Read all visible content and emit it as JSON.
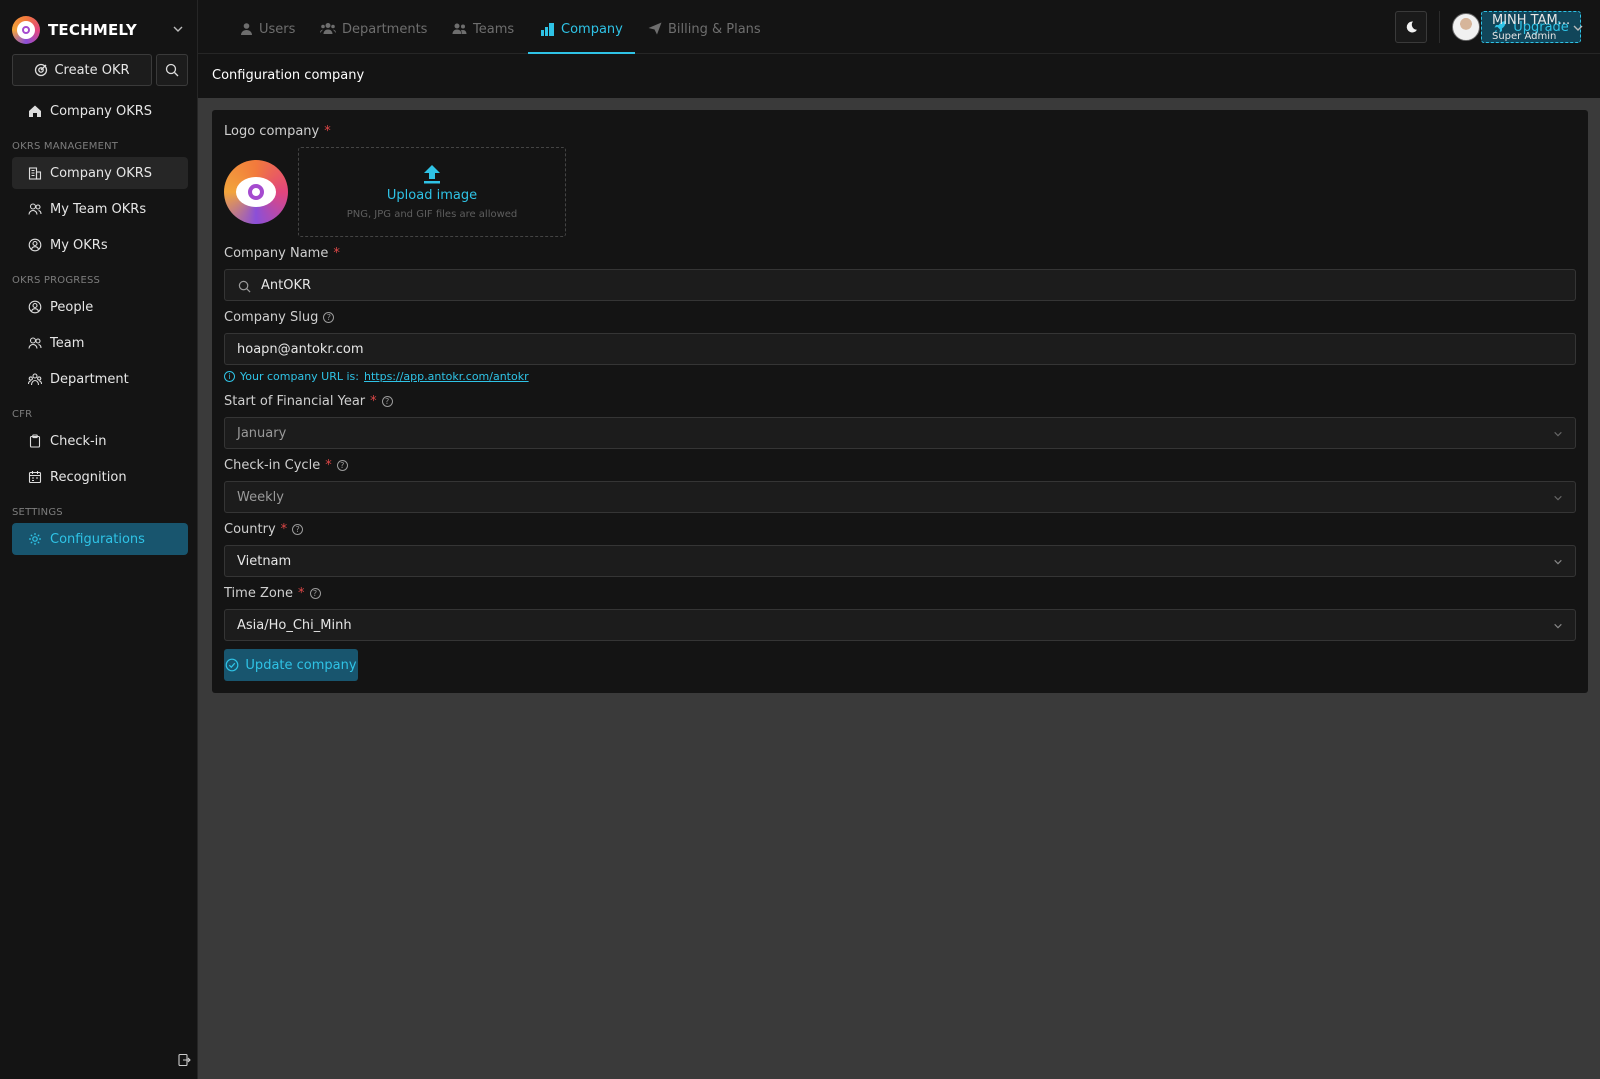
{
  "brand": {
    "name": "TECHMELY"
  },
  "sidebar": {
    "create_okr": "Create OKR",
    "home": "Company OKRS",
    "sections": [
      {
        "title": "OKRS MANAGEMENT",
        "items": [
          "Company OKRS",
          "My Team OKRs",
          "My OKRs"
        ]
      },
      {
        "title": "OKRS PROGRESS",
        "items": [
          "People",
          "Team",
          "Department"
        ]
      },
      {
        "title": "CFR",
        "items": [
          "Check-in",
          "Recognition"
        ]
      },
      {
        "title": "SETTINGS",
        "items": [
          "Configurations"
        ]
      }
    ]
  },
  "topbar": {
    "tabs": [
      "Users",
      "Departments",
      "Teams",
      "Company",
      "Billing & Plans"
    ],
    "active_tab": "Company",
    "upgrade": "Upgrade",
    "user": {
      "name": "MINH TAM...",
      "role": "Super Admin"
    }
  },
  "page": {
    "title": "Configuration company"
  },
  "form": {
    "logo": {
      "label": "Logo company",
      "upload_title": "Upload image",
      "upload_hint": "PNG, JPG and GIF files are allowed"
    },
    "company_name": {
      "label": "Company Name",
      "value": "AntOKR"
    },
    "company_slug": {
      "label": "Company Slug",
      "value": "hoapn@antokr.com",
      "hint_prefix": "Your company URL is:",
      "hint_link": "https://app.antokr.com/antokr"
    },
    "financial_year": {
      "label": "Start of Financial Year",
      "value": "January"
    },
    "checkin_cycle": {
      "label": "Check-in Cycle",
      "value": "Weekly"
    },
    "country": {
      "label": "Country",
      "value": "Vietnam"
    },
    "timezone": {
      "label": "Time Zone",
      "value": "Asia/Ho_Chi_Minh"
    },
    "submit": "Update company"
  },
  "colors": {
    "accent": "#2fc3e6",
    "accent_bg": "#18556e",
    "required": "#e04848"
  }
}
